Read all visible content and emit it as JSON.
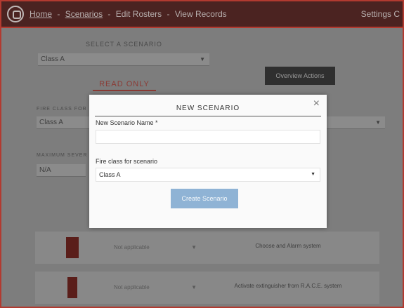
{
  "topbar": {
    "nav": [
      "Home",
      "Scenarios",
      "Edit Rosters",
      "View Records"
    ],
    "separator": " - ",
    "settings": "Settings C"
  },
  "background": {
    "select_label": "SELECT A SCENARIO",
    "select_value": "Class A",
    "read_only_tab": "READ ONLY",
    "overview_button": "Overview Actions",
    "fire_class_label": "FIRE CLASS FOR",
    "fire_class_value": "Class A",
    "maximum_label": "MAXIMUM SEVER",
    "maximum_value": "N/A",
    "rows": [
      {
        "dropdown": "Not applicable",
        "description": "Choose and Alarm system"
      },
      {
        "dropdown": "Not applicable",
        "description": "Activate extinguisher from R.A.C.E. system"
      }
    ]
  },
  "modal": {
    "title": "NEW SCENARIO",
    "close": "×",
    "name_label": "New Scenario Name *",
    "name_value": "",
    "fire_class_label": "Fire class for scenario",
    "fire_class_value": "Class A",
    "create_button": "Create Scenario"
  }
}
